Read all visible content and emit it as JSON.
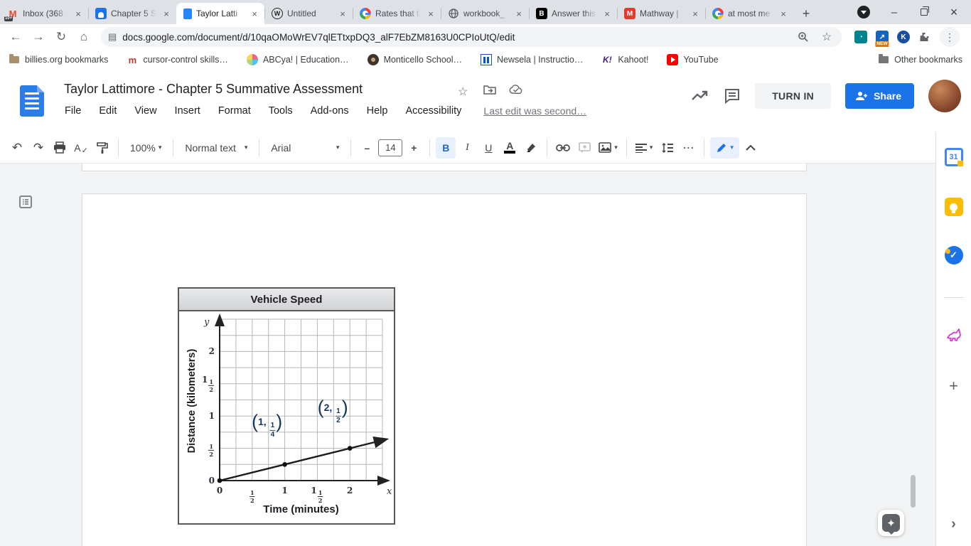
{
  "glyphs": {
    "close": "×",
    "plus": "+",
    "kebab": "⋮",
    "back": "←",
    "forward": "→",
    "reload": "↻",
    "home": "⌂",
    "star": "☆",
    "minimize": "–",
    "dots": "⋯",
    "undo": "↶",
    "redo": "↷",
    "caret": "▾",
    "check": "✓",
    "chevron_right": "›",
    "sparkle": "✦",
    "site": "▤",
    "w": "W",
    "g_m": "M",
    "b": "B",
    "k_excl": "K!",
    "m_lower": "m",
    "cal_day": "31",
    "tasks_check": "✓"
  },
  "browser": {
    "tabs": [
      {
        "label": "Inbox (368",
        "badge": "10+",
        "active": false
      },
      {
        "label": "Chapter 5 S",
        "active": false
      },
      {
        "label": "Taylor Latti",
        "active": true
      },
      {
        "label": "Untitled",
        "active": false
      },
      {
        "label": "Rates that t",
        "active": false
      },
      {
        "label": "workbook_",
        "active": false
      },
      {
        "label": "Answer this",
        "active": false
      },
      {
        "label": "Mathway | ",
        "active": false
      },
      {
        "label": "at most me",
        "active": false
      }
    ],
    "url": "docs.google.com/document/d/10qaOMoWrEV7qlETtxpDQ3_alF7EbZM8163U0CPIoUtQ/edit",
    "extension_badge": "NEW",
    "bookmarks": [
      "billies.org bookmarks",
      "cursor-control skills…",
      "ABCya! | Education…",
      "Monticello School…",
      "Newsela | Instructio…",
      "Kahoot!",
      "YouTube"
    ],
    "other_bookmarks": "Other bookmarks"
  },
  "docs": {
    "title": "Taylor Lattimore - Chapter 5 Summative Assessment",
    "menus": [
      "File",
      "Edit",
      "View",
      "Insert",
      "Format",
      "Tools",
      "Add-ons",
      "Help",
      "Accessibility"
    ],
    "last_edit": "Last edit was second…",
    "turn_in_label": "TURN IN",
    "share_label": "Share",
    "toolbar": {
      "zoom": "100%",
      "style": "Normal text",
      "font": "Arial",
      "size": "14",
      "bold": "B",
      "italic": "I",
      "underline": "U",
      "color": "A",
      "spell": "A"
    }
  },
  "chart_data": {
    "type": "line",
    "title": "Vehicle Speed",
    "xlabel": "Time (minutes)",
    "ylabel": "Distance (kilometers)",
    "x_var": "x",
    "y_var": "y",
    "xlim": [
      0,
      2.5
    ],
    "ylim": [
      0,
      2.5
    ],
    "grid_step": 0.25,
    "grid": true,
    "x_ticks": [
      {
        "v": 0,
        "label": "0"
      },
      {
        "v": 0.5,
        "label": "½"
      },
      {
        "v": 1,
        "label": "1"
      },
      {
        "v": 1.5,
        "label": "1½"
      },
      {
        "v": 2,
        "label": "2"
      }
    ],
    "y_ticks": [
      {
        "v": 0,
        "label": "0"
      },
      {
        "v": 0.5,
        "label": "½"
      },
      {
        "v": 1,
        "label": "1"
      },
      {
        "v": 1.5,
        "label": "1½"
      },
      {
        "v": 2,
        "label": "2"
      }
    ],
    "points": [
      {
        "x": 0,
        "y": 0
      },
      {
        "x": 1,
        "y": 0.25
      },
      {
        "x": 2,
        "y": 0.5
      }
    ],
    "line": {
      "from": {
        "x": 0,
        "y": 0
      },
      "to": {
        "x": 2.55,
        "y": 0.6375
      }
    },
    "point_labels": [
      {
        "text": "(1, ¼)",
        "x": 1,
        "y": 0.25,
        "dx": -25,
        "dy": -52
      },
      {
        "text": "(2, ½)",
        "x": 2,
        "y": 0.5,
        "dx": -24,
        "dy": -50
      }
    ]
  }
}
